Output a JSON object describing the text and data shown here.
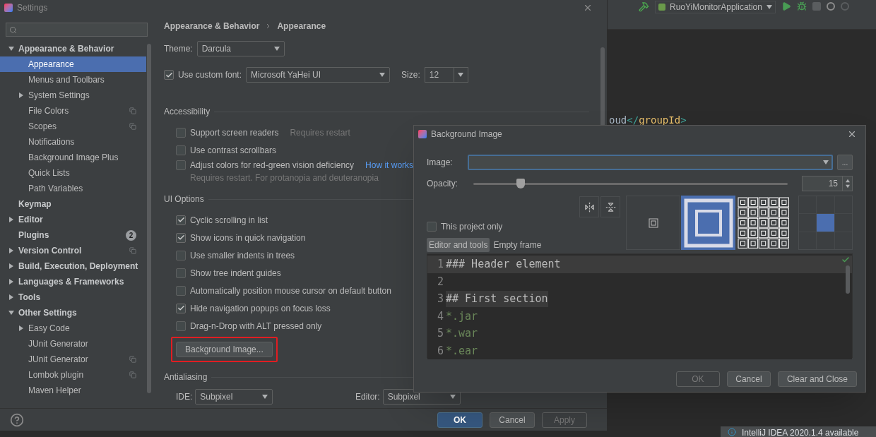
{
  "settings": {
    "title": "Settings",
    "sidebar": {
      "items": [
        {
          "label": "Appearance & Behavior",
          "bold": true,
          "expanded": true,
          "selected": false,
          "children": [
            {
              "label": "Appearance",
              "selected": true
            },
            {
              "label": "Menus and Toolbars",
              "selected": false
            },
            {
              "label": "System Settings",
              "expanded": false,
              "selected": false
            },
            {
              "label": "File Colors",
              "project_level": true,
              "selected": false
            },
            {
              "label": "Scopes",
              "project_level": true,
              "selected": false
            },
            {
              "label": "Notifications",
              "selected": false
            },
            {
              "label": "Background Image Plus",
              "selected": false
            },
            {
              "label": "Quick Lists",
              "selected": false
            },
            {
              "label": "Path Variables",
              "selected": false
            }
          ]
        },
        {
          "label": "Keymap",
          "bold": true,
          "selected": false
        },
        {
          "label": "Editor",
          "bold": true,
          "expanded": false,
          "selected": false
        },
        {
          "label": "Plugins",
          "bold": true,
          "badge": "2",
          "selected": false
        },
        {
          "label": "Version Control",
          "bold": true,
          "expanded": false,
          "project_level": true,
          "selected": false
        },
        {
          "label": "Build, Execution, Deployment",
          "bold": true,
          "expanded": false,
          "selected": false
        },
        {
          "label": "Languages & Frameworks",
          "bold": true,
          "expanded": false,
          "selected": false
        },
        {
          "label": "Tools",
          "bold": true,
          "expanded": false,
          "selected": false
        },
        {
          "label": "Other Settings",
          "bold": true,
          "expanded": true,
          "selected": false,
          "children": [
            {
              "label": "Easy Code",
              "expanded": false,
              "selected": false
            },
            {
              "label": "JUnit Generator",
              "selected": false
            },
            {
              "label": "JUnit Generator",
              "project_level": true,
              "selected": false
            },
            {
              "label": "Lombok plugin",
              "project_level": true,
              "selected": false
            },
            {
              "label": "Maven Helper",
              "selected": false
            }
          ]
        }
      ]
    },
    "breadcrumb": [
      "Appearance & Behavior",
      "Appearance"
    ],
    "theme": {
      "label": "Theme:",
      "value": "Darcula"
    },
    "custom_font": {
      "label": "Use custom font:",
      "checked": true,
      "value": "Microsoft YaHei UI",
      "size_label": "Size:",
      "size": "12"
    },
    "sections": [
      {
        "title": "Accessibility",
        "options": [
          {
            "label": "Support screen readers",
            "checked": false,
            "note": "Requires restart"
          },
          {
            "label": "Use contrast scrollbars",
            "checked": false
          },
          {
            "label": "Adjust colors for red-green vision deficiency",
            "checked": false,
            "link": "How it works",
            "hint": "Requires restart. For protanopia and deuteranopia"
          }
        ]
      },
      {
        "title": "UI Options",
        "options": [
          {
            "label": "Cyclic scrolling in list",
            "checked": true
          },
          {
            "label": "Show icons in quick navigation",
            "checked": true
          },
          {
            "label": "Use smaller indents in trees",
            "checked": false
          },
          {
            "label": "Show tree indent guides",
            "checked": false
          },
          {
            "label": "Automatically position mouse cursor on default button",
            "checked": false
          },
          {
            "label": "Hide navigation popups on focus loss",
            "checked": true
          },
          {
            "label": "Drag-n-Drop with ALT pressed only",
            "checked": false
          }
        ],
        "button": {
          "label": "Background Image...",
          "highlighted": true
        }
      },
      {
        "title": "Antialiasing",
        "selects": [
          {
            "label": "IDE:",
            "value": "Subpixel"
          },
          {
            "label": "Editor:",
            "value": "Subpixel"
          }
        ]
      }
    ],
    "buttons": [
      {
        "label": "OK",
        "kind": "primary"
      },
      {
        "label": "Cancel",
        "kind": "normal"
      },
      {
        "label": "Apply",
        "kind": "disabled"
      }
    ]
  },
  "ide": {
    "run_config": "RuoYiMonitorApplication",
    "code": [
      {
        "text": "oud",
        "kind": "plain"
      },
      {
        "text": "</",
        "kind": "bracket"
      },
      {
        "text": "groupId",
        "kind": "tag"
      },
      {
        "text": ">",
        "kind": "bracket"
      }
    ],
    "notification": "IntelliJ IDEA 2020.1.4 available"
  },
  "background_dialog": {
    "title": "Background Image",
    "image": {
      "label": "Image:",
      "browse": "..."
    },
    "opacity": {
      "label": "Opacity:",
      "level": 0.15,
      "value": "15"
    },
    "this_project_only": {
      "label": "This project only",
      "checked": false
    },
    "tabs": [
      {
        "label": "Editor and tools",
        "selected": true
      },
      {
        "label": "Empty frame",
        "selected": false
      }
    ],
    "fill_modes": [
      {
        "kind": "center",
        "selected": false
      },
      {
        "kind": "scale",
        "selected": true
      },
      {
        "kind": "tile",
        "selected": false
      },
      {
        "kind": "anchor",
        "selected": false,
        "cells": [
          {
            "selected": false
          },
          {
            "selected": false
          },
          {
            "selected": false
          },
          {
            "selected": false
          },
          {
            "selected": true
          },
          {
            "selected": false
          },
          {
            "selected": false
          },
          {
            "selected": false
          },
          {
            "selected": false
          }
        ]
      }
    ],
    "preview": [
      {
        "number": "1",
        "text": "### Header element",
        "kind": "heading",
        "current": true
      },
      {
        "number": "2",
        "kind": "blank",
        "current": false
      },
      {
        "number": "3",
        "text": "## First section",
        "kind": "section",
        "current": false
      },
      {
        "number": "4",
        "text": "*.jar",
        "kind": "pattern",
        "current": false
      },
      {
        "number": "5",
        "text": "*.war",
        "kind": "pattern",
        "current": false
      },
      {
        "number": "6",
        "text": "*.ear",
        "kind": "pattern",
        "current": false
      }
    ],
    "buttons": [
      {
        "label": "OK",
        "kind": "disabled"
      },
      {
        "label": "Cancel",
        "kind": "normal"
      },
      {
        "label": "Clear and Close",
        "kind": "normal"
      }
    ]
  }
}
